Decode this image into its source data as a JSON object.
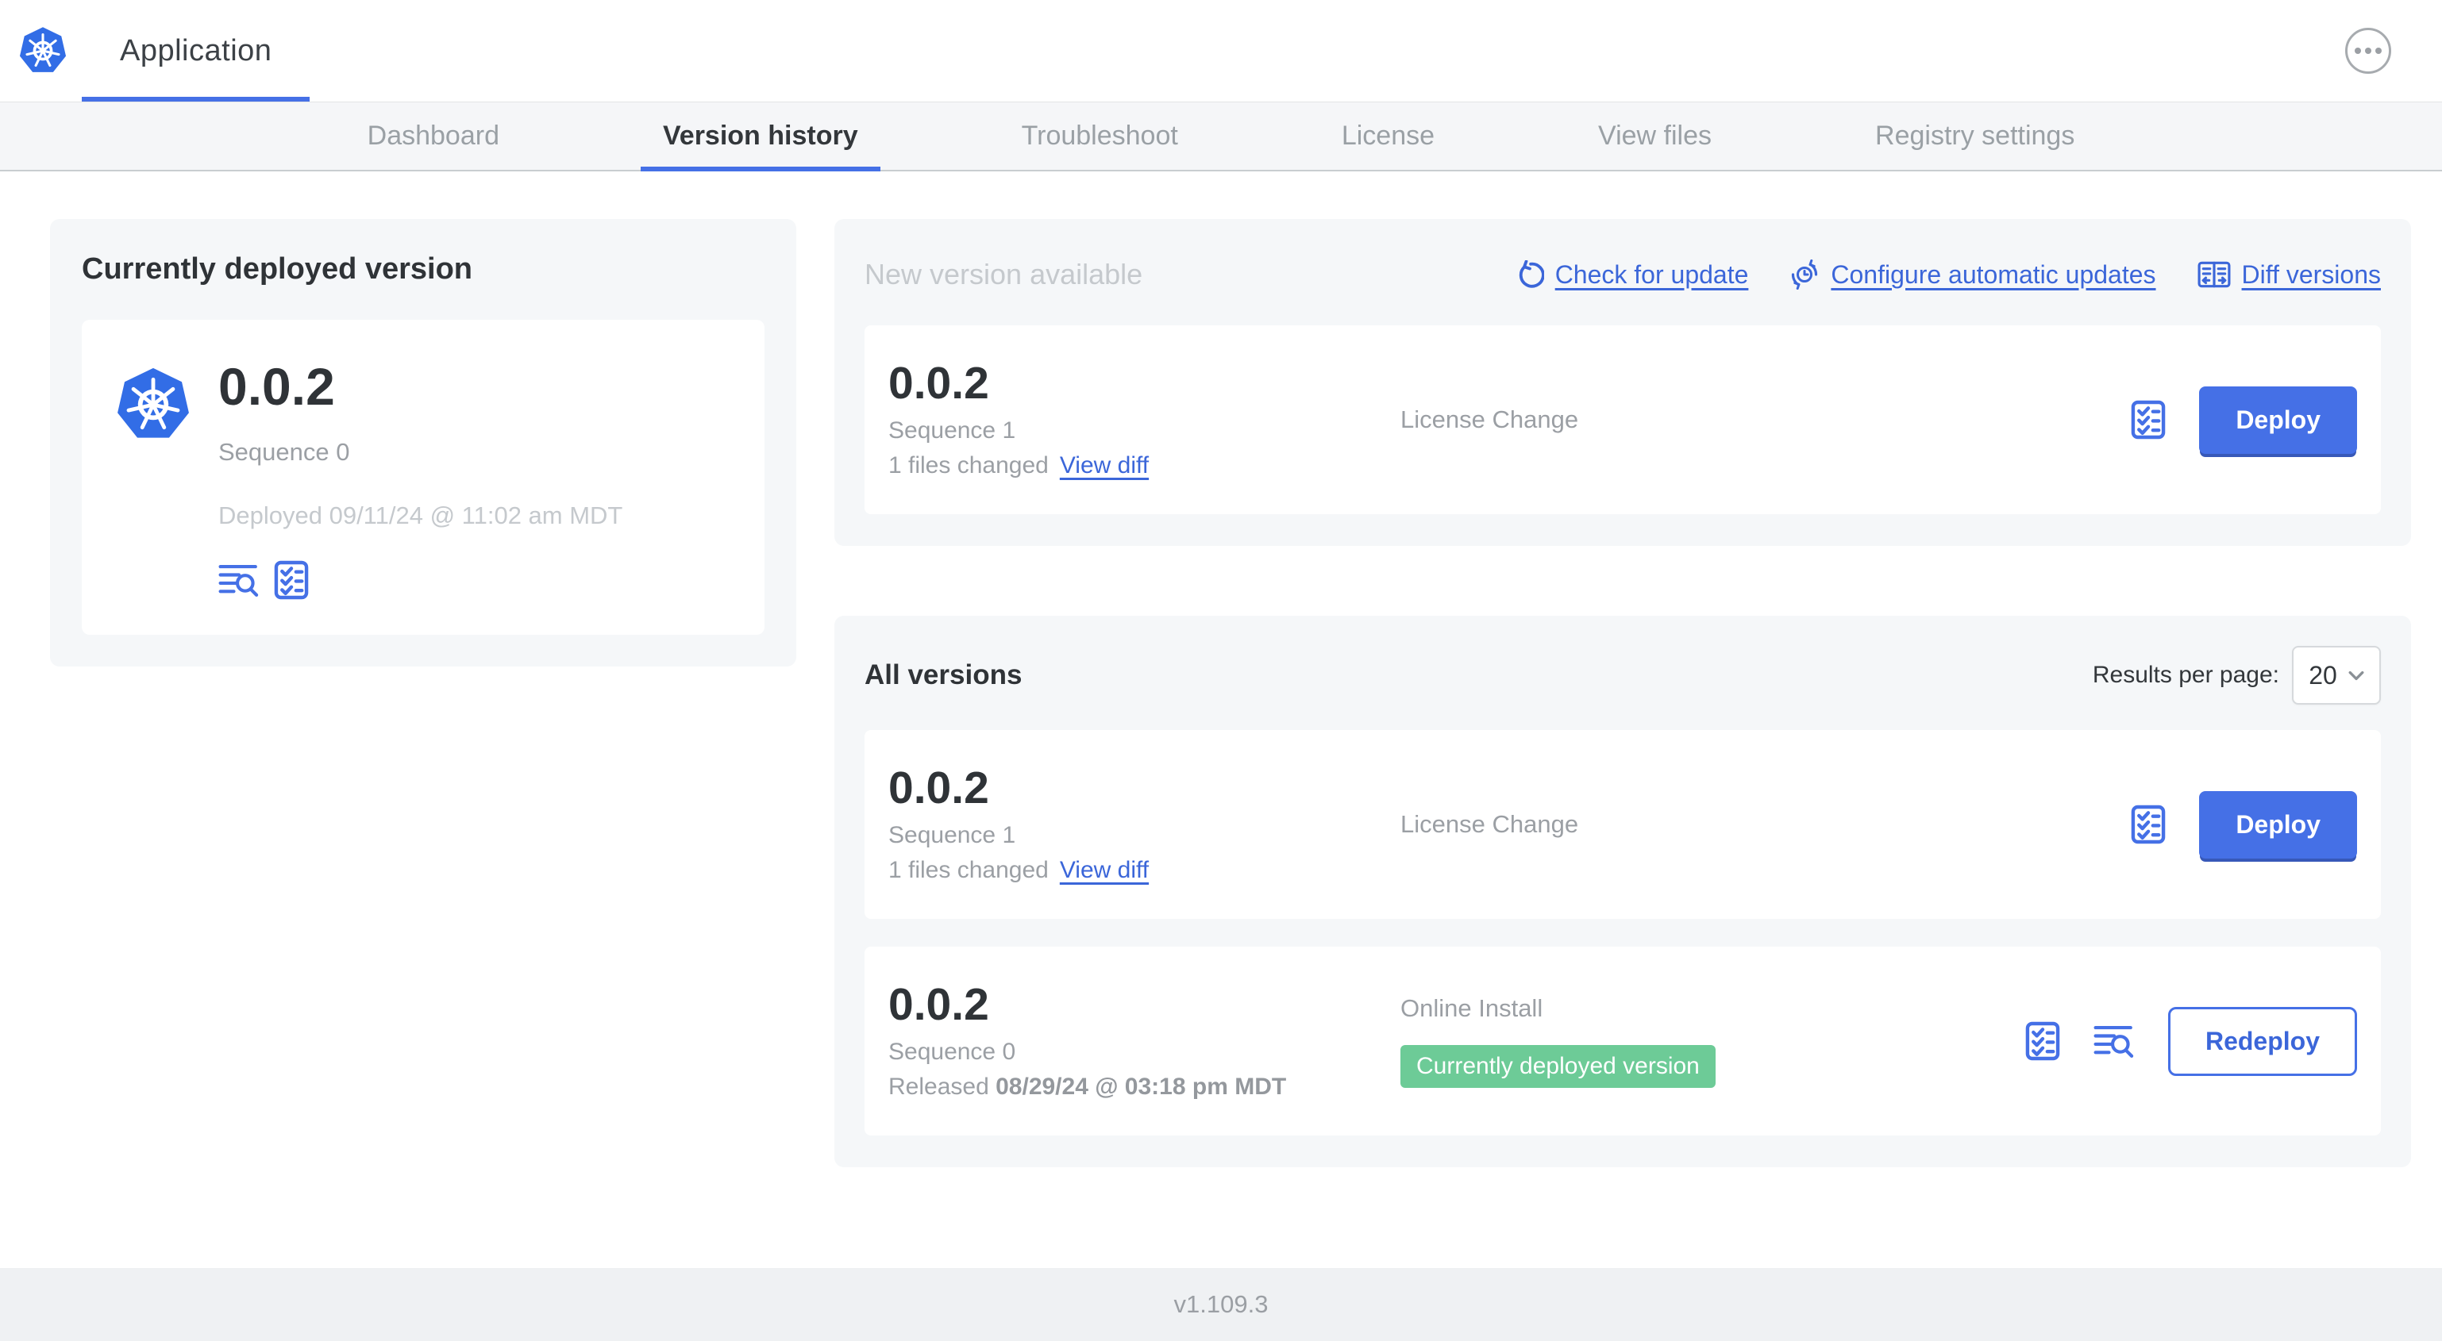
{
  "header": {
    "app_tab": "Application",
    "logo_icon": "kubernetes-logo",
    "menu_icon": "ellipsis-menu-icon"
  },
  "nav": {
    "tabs": [
      {
        "label": "Dashboard",
        "active": false
      },
      {
        "label": "Version history",
        "active": true
      },
      {
        "label": "Troubleshoot",
        "active": false
      },
      {
        "label": "License",
        "active": false
      },
      {
        "label": "View files",
        "active": false
      },
      {
        "label": "Registry settings",
        "active": false
      }
    ]
  },
  "currently_deployed": {
    "title": "Currently deployed version",
    "version": "0.0.2",
    "sequence": "Sequence 0",
    "deployed": "Deployed 09/11/24 @ 11:02 am MDT",
    "icons": [
      "logs-icon",
      "preflight-checklist-icon"
    ]
  },
  "new_version": {
    "title": "New version available",
    "links": {
      "check": "Check for update",
      "configure": "Configure automatic updates",
      "diff": "Diff versions"
    },
    "link_icons": [
      "refresh-icon",
      "schedule-update-icon",
      "diff-icon"
    ],
    "row": {
      "version": "0.0.2",
      "sequence": "Sequence 1",
      "files_changed": "1 files changed",
      "view_diff": "View diff",
      "source": "License Change",
      "action": "Deploy"
    }
  },
  "all_versions": {
    "title": "All versions",
    "results_label": "Results per page:",
    "results_value": "20",
    "rows": [
      {
        "version": "0.0.2",
        "sequence": "Sequence 1",
        "files_changed": "1 files changed",
        "view_diff": "View diff",
        "source": "License Change",
        "action": "Deploy"
      },
      {
        "version": "0.0.2",
        "sequence": "Sequence 0",
        "released_label": "Released",
        "released_date": "08/29/24 @ 03:18 pm MDT",
        "source": "Online Install",
        "badge": "Currently deployed version",
        "action": "Redeploy"
      }
    ]
  },
  "footer": {
    "version": "v1.109.3"
  },
  "colors": {
    "accent_blue": "#4570e6",
    "link_blue": "#3b66d9",
    "badge_green": "#6dcb97",
    "panel_gray": "#f5f7f9",
    "text_dark": "#2f3337",
    "text_gray": "#9b9fa4",
    "text_light_gray": "#c5c9cd"
  }
}
